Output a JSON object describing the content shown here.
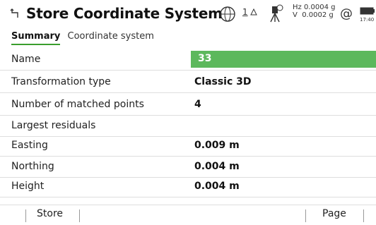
{
  "header": {
    "title": "Store Coordinate System",
    "count": "1",
    "hz_reading": "Hz 0.0004 g",
    "v_reading": "V  0.0002 g",
    "at_symbol": "@",
    "time": "17:40"
  },
  "tabs": [
    {
      "label": "Summary",
      "active": true
    },
    {
      "label": "Coordinate system",
      "active": false
    }
  ],
  "fields": {
    "name": {
      "label": "Name",
      "value": "33"
    },
    "transformation_type": {
      "label": "Transformation type",
      "value": "Classic 3D"
    },
    "matched_points": {
      "label": "Number of matched points",
      "value": "4"
    },
    "largest_residuals": {
      "label": "Largest residuals"
    },
    "easting": {
      "label": "Easting",
      "value": "0.009 m"
    },
    "northing": {
      "label": "Northing",
      "value": "0.004 m"
    },
    "height": {
      "label": "Height",
      "value": "0.004 m"
    }
  },
  "footer": {
    "store_label": "Store",
    "page_label": "Page"
  },
  "colors": {
    "accent": "#5cb85c",
    "tab_underline": "#3a9e2d"
  }
}
